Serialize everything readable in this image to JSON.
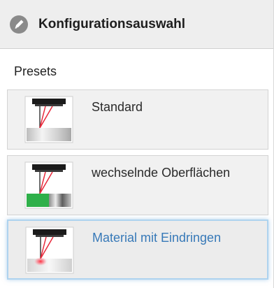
{
  "panel": {
    "title": "Konfigurationsauswahl",
    "icon": "pencil-icon",
    "section_label": "Presets"
  },
  "presets": [
    {
      "label": "Standard",
      "selected": false,
      "icon": "sensor-standard-icon"
    },
    {
      "label": "wechselnde Oberflächen",
      "selected": false,
      "icon": "sensor-changing-surfaces-icon"
    },
    {
      "label": "Material mit Eindringen",
      "selected": true,
      "icon": "sensor-penetration-icon"
    }
  ],
  "colors": {
    "selected_text": "#3779b8",
    "selected_border": "#aed3ef",
    "laser": "#e8283a",
    "green_surface": "#2fb04a"
  }
}
